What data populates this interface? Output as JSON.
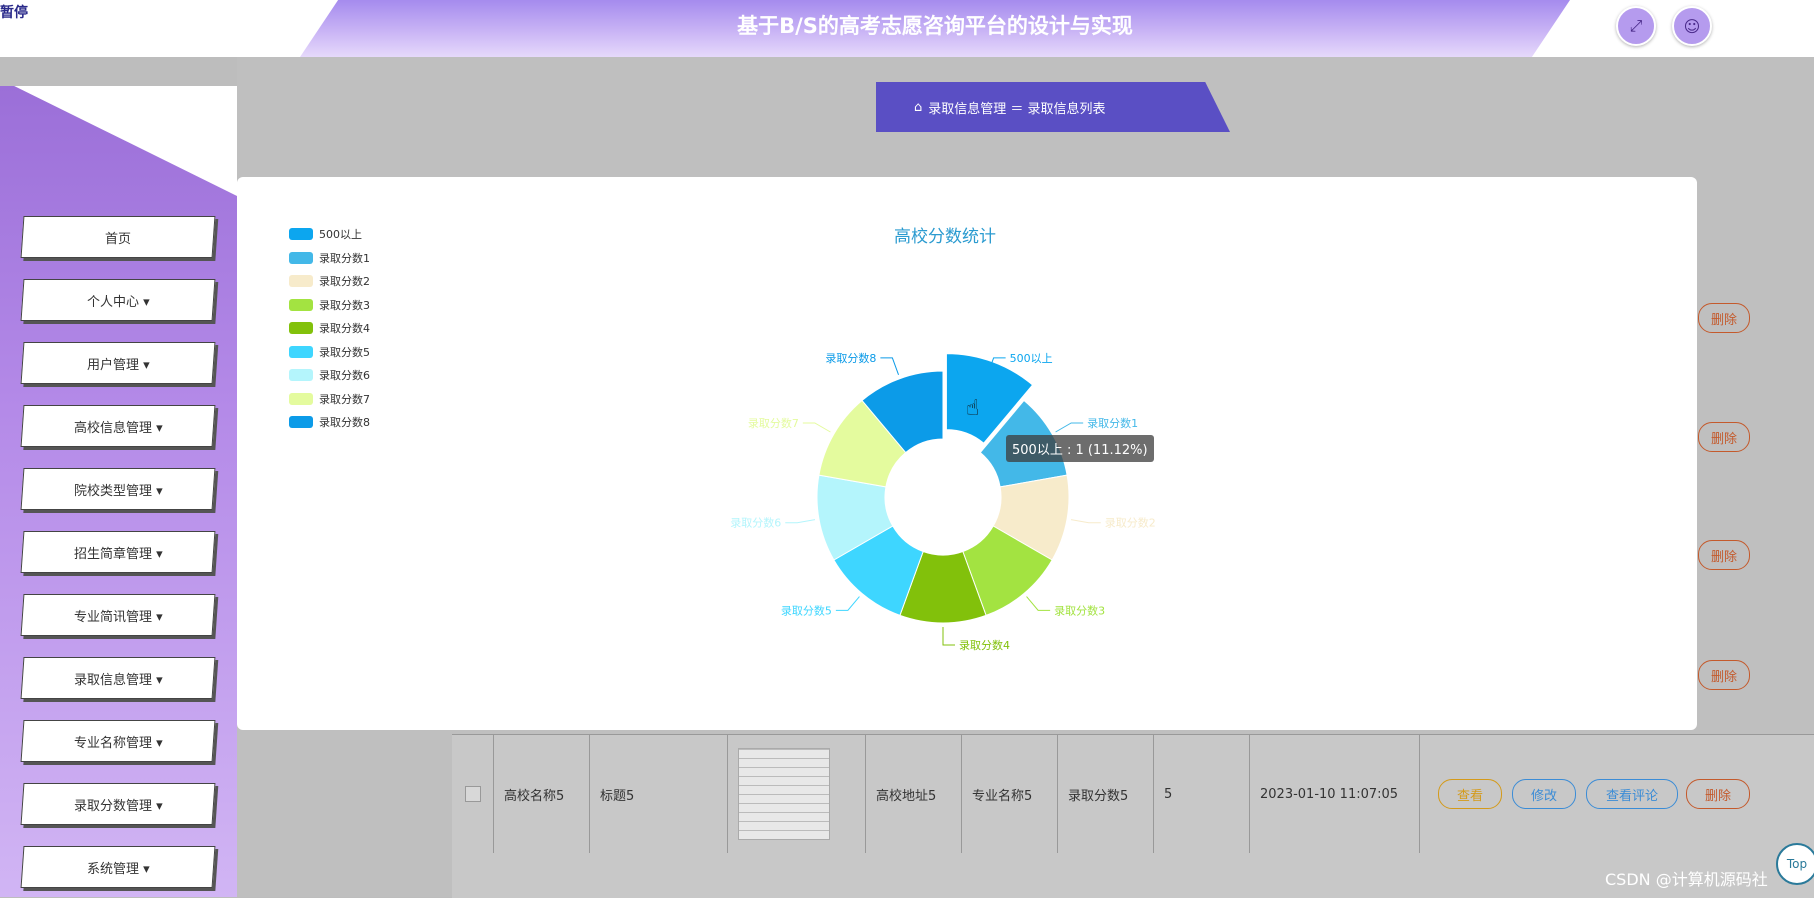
{
  "header": {
    "corner_tag": "暂停",
    "title": "基于B/S的高考志愿咨询平台的设计与实现",
    "fullscreen_icon": "fullscreen-icon",
    "user_icon": "user-icon"
  },
  "sidebar": {
    "items": [
      {
        "label": "首页"
      },
      {
        "label": "个人中心 ▾"
      },
      {
        "label": "用户管理 ▾"
      },
      {
        "label": "高校信息管理 ▾"
      },
      {
        "label": "院校类型管理 ▾"
      },
      {
        "label": "招生简章管理 ▾"
      },
      {
        "label": "专业简讯管理 ▾"
      },
      {
        "label": "录取信息管理 ▾"
      },
      {
        "label": "专业名称管理 ▾"
      },
      {
        "label": "录取分数管理 ▾"
      },
      {
        "label": "系统管理 ▾"
      }
    ]
  },
  "breadcrumb": {
    "home_icon": "home-icon",
    "text": "录取信息管理 ＝ 录取信息列表"
  },
  "table": {
    "row5": {
      "school": "高校名称5",
      "title": "标题5",
      "address": "高校地址5",
      "major": "专业名称5",
      "score": "录取分数5",
      "count": "5",
      "time": "2023-01-10 11:07:05",
      "btn_view": "查看",
      "btn_edit": "修改",
      "btn_comment": "查看评论",
      "btn_delete": "删除"
    },
    "side_delete": "删除"
  },
  "chart_data": {
    "type": "pie",
    "title": "高校分数统计",
    "categories": [
      "500以上",
      "录取分数1",
      "录取分数2",
      "录取分数3",
      "录取分数4",
      "录取分数5",
      "录取分数6",
      "录取分数7",
      "录取分数8"
    ],
    "values": [
      1,
      1,
      1,
      1,
      1,
      1,
      1,
      1,
      1
    ],
    "colors": [
      "#0ca6ef",
      "#43b8e8",
      "#f7ebcb",
      "#a3e341",
      "#82c10b",
      "#3ed6ff",
      "#b4f5fc",
      "#e4fb9e",
      "#0c9be8"
    ],
    "legend_position": "top-left",
    "donut": true,
    "tooltip": "500以上 : 1 (11.12%)"
  },
  "footer": {
    "watermark": "CSDN @计算机源码社",
    "top_label": "Top"
  }
}
